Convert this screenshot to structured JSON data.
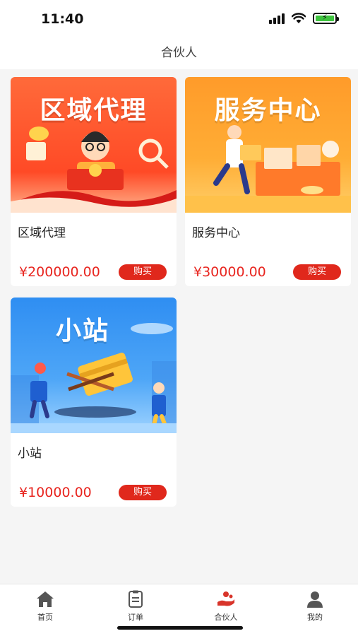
{
  "status_bar": {
    "time": "11:40"
  },
  "header": {
    "title": "合伙人"
  },
  "products": [
    {
      "image_title": "区域代理",
      "name": "区域代理",
      "price": "¥200000.00",
      "buy_label": "购买"
    },
    {
      "image_title": "服务中心",
      "name": "服务中心",
      "price": "¥30000.00",
      "buy_label": "购买"
    },
    {
      "image_title": "小站",
      "name": "小站",
      "price": "¥10000.00",
      "buy_label": "购买"
    }
  ],
  "tabs": [
    {
      "label": "首页",
      "icon": "home-icon",
      "active": false
    },
    {
      "label": "订单",
      "icon": "order-icon",
      "active": false
    },
    {
      "label": "合伙人",
      "icon": "partner-icon",
      "active": true
    },
    {
      "label": "我的",
      "icon": "user-icon",
      "active": false
    }
  ],
  "colors": {
    "price": "#e8251f",
    "buy_button": "#e0281c",
    "active_tab_icon": "#d8342a",
    "tab_icon": "#555555"
  }
}
